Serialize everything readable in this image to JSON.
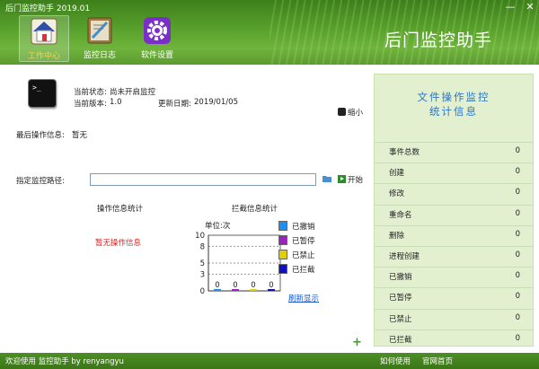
{
  "titlebar": {
    "title": "后门监控助手 2019.01",
    "minimize": "—",
    "close": "✕"
  },
  "brand": "后门监控助手",
  "nav": [
    {
      "label": "工作中心",
      "icon": "house-icon",
      "active": true
    },
    {
      "label": "监控日志",
      "icon": "log-icon",
      "active": false
    },
    {
      "label": "软件设置",
      "icon": "gear-icon",
      "active": false
    }
  ],
  "status": {
    "state_label": "当前状态:",
    "state_value": "尚未开启监控",
    "version_label": "当前版本:",
    "version_value": "1.0",
    "update_label": "更新日期:",
    "update_value": "2019/01/05",
    "minimize_label": "缩小",
    "last_op_label": "最后操作信息:",
    "last_op_value": "暂无"
  },
  "monitor": {
    "path_label": "指定监控路径:",
    "path_value": "",
    "start_label": "开始"
  },
  "op_stats": {
    "title": "操作信息统计",
    "empty": "暂无操作信息"
  },
  "chart_data": {
    "type": "bar",
    "title": "拦截信息统计",
    "ylabel": "单位:次",
    "yticks": [
      "10",
      "8",
      "5",
      "3",
      "0"
    ],
    "ylim": [
      0,
      10
    ],
    "categories": [
      "已撤销",
      "已暂停",
      "已禁止",
      "已拦截"
    ],
    "values": [
      0,
      0,
      0,
      0
    ],
    "value_labels": [
      "0",
      "0",
      "0",
      "0"
    ],
    "colors": [
      "#1e8ff0",
      "#a020c0",
      "#e0d000",
      "#1010c0"
    ],
    "refresh_label": "刷新显示"
  },
  "right_panel": {
    "title_line1": "文件操作监控",
    "title_line2": "统计信息",
    "rows": [
      {
        "label": "事件总数",
        "value": "0"
      },
      {
        "label": "创建",
        "value": "0"
      },
      {
        "label": "修改",
        "value": "0"
      },
      {
        "label": "重命名",
        "value": "0"
      },
      {
        "label": "删除",
        "value": "0"
      },
      {
        "label": "进程创建",
        "value": "0"
      },
      {
        "label": "已撤销",
        "value": "0"
      },
      {
        "label": "已暂停",
        "value": "0"
      },
      {
        "label": "已禁止",
        "value": "0"
      },
      {
        "label": "已拦截",
        "value": "0"
      }
    ]
  },
  "footer": {
    "welcome": "欢迎使用 监控助手 by renyangyu",
    "help": "如何使用",
    "about": "官网首页"
  },
  "add_button": "+"
}
